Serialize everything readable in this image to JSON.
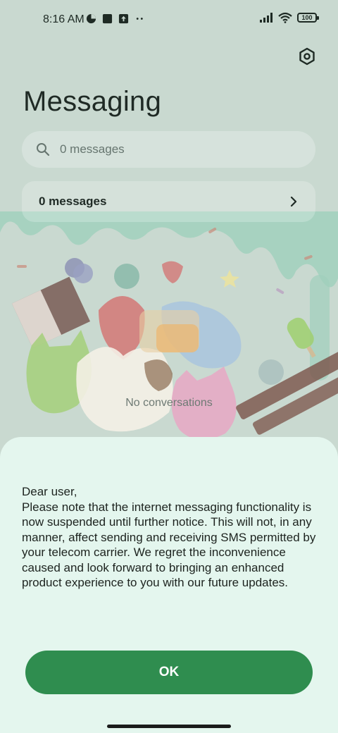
{
  "status_bar": {
    "time": "8:16 AM",
    "battery": "100"
  },
  "header": {
    "title": "Messaging"
  },
  "search": {
    "placeholder": "0 messages"
  },
  "summary": {
    "label": "0 messages"
  },
  "empty_state": {
    "text": "No conversations"
  },
  "dialog": {
    "message": "Dear user,\nPlease note that the internet messaging functionality is now suspended until further notice. This will not, in any manner, affect sending and receiving SMS permitted by your telecom carrier. We regret the inconvenience caused and look forward to bringing an enhanced product experience to you with our future updates.",
    "ok_label": "OK"
  },
  "colors": {
    "accent": "#2f8d4f",
    "dialog_bg": "#e4f6ee",
    "page_bg": "#c9d9d0"
  }
}
